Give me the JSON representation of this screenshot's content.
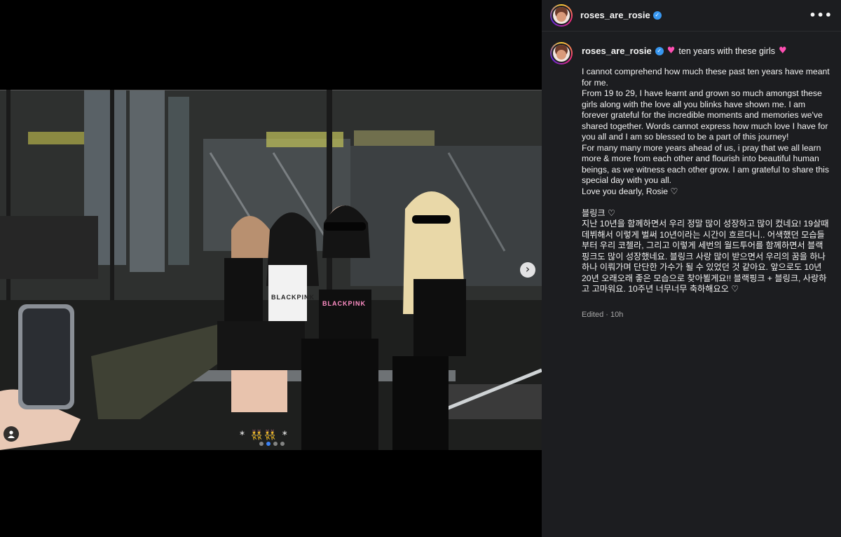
{
  "post": {
    "username": "roses_are_rosie",
    "verified_mark": "✓",
    "more_icon": "•••",
    "caption_title": "ten years with these girls",
    "heart_emoji": "♥",
    "caption_body": "I cannot comprehend how much these past ten years have meant for me.\nFrom 19 to 29, I have learnt and grown so much amongst these girls along with the love all you blinks have shown me. I am forever grateful for the incredible moments and memories we've shared together. Words cannot express how much love I have for you all and I am so blessed to be a part of this journey!\nFor many many more years ahead of us, i pray that we all learn more & more from each other and flourish into beautiful human beings, as we witness each other grow. I am grateful to share this special day with you all.\nLove you dearly, Rosie ♡\n\n블링크 ♡\n지난 10년을 함께하면서 우리 정말 많이 성장하고 많이 컸네요! 19살때 데뷔해서 이렇게 벌써 10년이라는 시간이 흐르다니.. 어색했던 모습들 부터 우리 코첼라, 그리고 이렇게 세번의 월드투어를 함께하면서 블랙핑크도 많이 성장했네요. 블링크 사랑 많이 받으면서 우리의 꿈을 하나하나 이뤄가며 단단한 가수가 될 수 있었던 것 같아요. 앞으로도 10년 20년 오래오래 좋은 모습으로 찾아뵐게요!! 블랙핑크 + 블링크, 사랑하고 고마워요. 10주년 너무너무 축하해요오 ♡",
    "edited_label": "Edited",
    "time_ago": "10h"
  },
  "media": {
    "next_icon": "›",
    "photo_caption": "* 👯👯 *",
    "top1_text": "BLACKPINK",
    "top2_text": "BLACKPINK",
    "carousel_count": 4,
    "carousel_active": 2
  },
  "colors": {
    "panel_bg": "#1c1d20",
    "accent_verified": "#3897f0",
    "heart": "#ff4fb3",
    "carousel_active": "#3b82f6"
  }
}
